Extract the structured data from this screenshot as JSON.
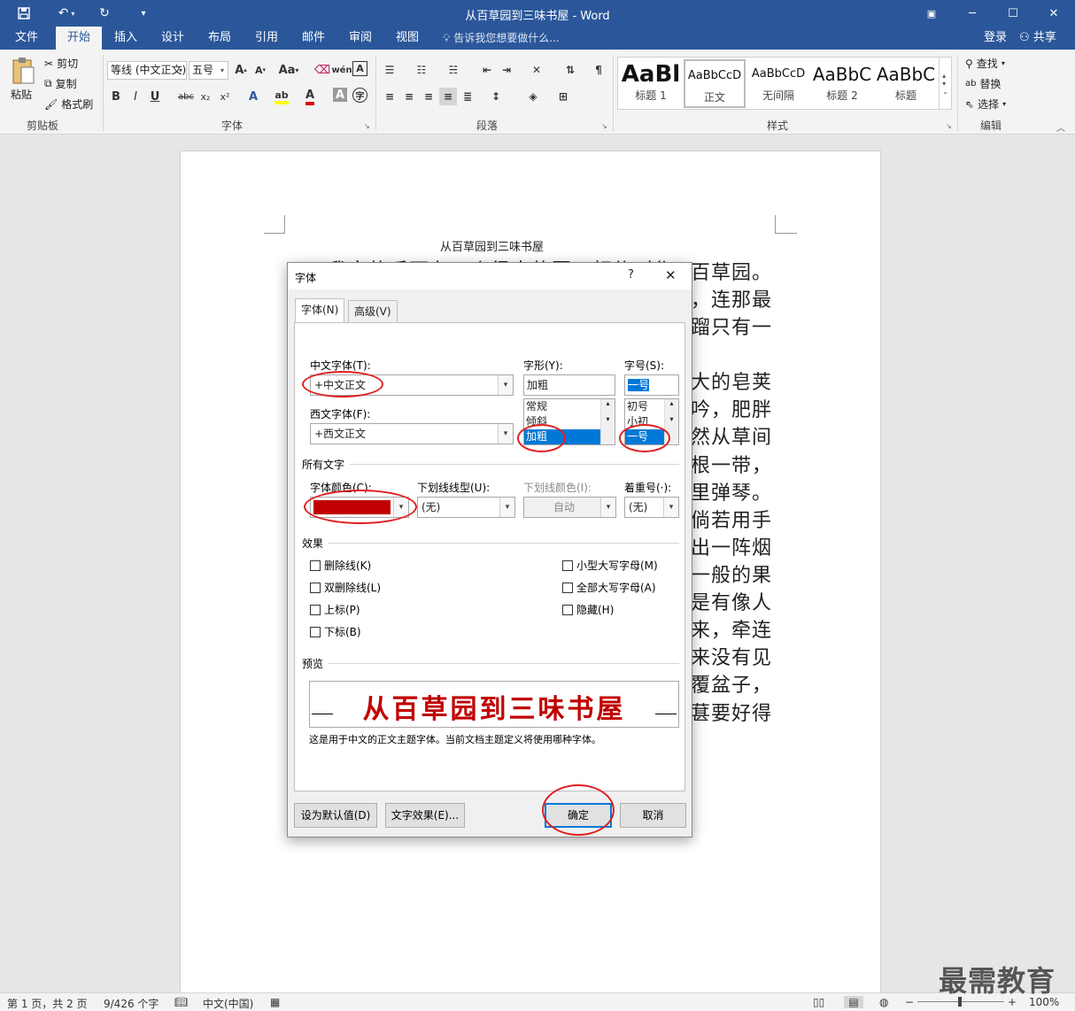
{
  "window": {
    "title": "从百草园到三味书屋 - Word"
  },
  "tabs": [
    {
      "label": "文件"
    },
    {
      "label": "开始"
    },
    {
      "label": "插入"
    },
    {
      "label": "设计"
    },
    {
      "label": "布局"
    },
    {
      "label": "引用"
    },
    {
      "label": "邮件"
    },
    {
      "label": "审阅"
    },
    {
      "label": "视图"
    }
  ],
  "tellme": "告诉我您想要做什么...",
  "account": {
    "login": "登录",
    "share": "共享"
  },
  "ribbon": {
    "clipboard": {
      "paste": "粘贴",
      "cut": "剪切",
      "copy": "复制",
      "format_painter": "格式刷",
      "label": "剪贴板"
    },
    "font": {
      "font_name": "等线 (中文正文)",
      "font_size": "五号",
      "label": "字体"
    },
    "paragraph": {
      "label": "段落"
    },
    "styles": {
      "label": "样式",
      "items": [
        {
          "preview": "AaBl",
          "name": "标题 1"
        },
        {
          "preview": "AaBbCcD",
          "name": "正文"
        },
        {
          "preview": "AaBbCcD",
          "name": "无间隔"
        },
        {
          "preview": "AaBbC",
          "name": "标题 2"
        },
        {
          "preview": "AaBbC",
          "name": "标题"
        }
      ]
    },
    "editing": {
      "find": "查找",
      "replace": "替换",
      "select": "选择",
      "label": "编辑"
    }
  },
  "document": {
    "header": "从百草园到三味书屋",
    "right_lines": [
      "百草园。",
      "，连那最",
      "蹓只有一",
      "大的皂荚",
      "吟，肥胖",
      "然从草间",
      "根一带，",
      "里弹琴。",
      "倘若用手",
      "出一阵烟",
      "一般的果",
      "是有像人",
      "来，牵连",
      "来没有见",
      "覆盆子，",
      "葚要好得"
    ],
    "top_line": "我家的后面有一个很大的园，相传叫作"
  },
  "dialog": {
    "title": "字体",
    "help": "?",
    "close": "✕",
    "tab_font": "字体(N)",
    "tab_advanced": "高级(V)",
    "cn_font_label": "中文字体(T):",
    "cn_font_value": "+中文正文",
    "style_label": "字形(Y):",
    "style_value": "加粗",
    "style_options": [
      "常规",
      "倾斜",
      "加粗"
    ],
    "size_label": "字号(S):",
    "size_value": "一号",
    "size_options": [
      "初号",
      "小初",
      "一号"
    ],
    "west_font_label": "西文字体(F):",
    "west_font_value": "+西文正文",
    "all_text_label": "所有文字",
    "font_color_label": "字体颜色(C):",
    "font_color_value": "#c00000",
    "underline_label": "下划线线型(U):",
    "underline_value": "(无)",
    "underline_color_label": "下划线颜色(I):",
    "underline_color_value": "自动",
    "emphasis_label": "着重号(·):",
    "emphasis_value": "(无)",
    "effects_label": "效果",
    "effects": {
      "strike": "删除线(K)",
      "double_strike": "双删除线(L)",
      "superscript": "上标(P)",
      "subscript": "下标(B)",
      "small_caps": "小型大写字母(M)",
      "all_caps": "全部大写字母(A)",
      "hidden": "隐藏(H)"
    },
    "preview_label": "预览",
    "preview_text": "从百草园到三味书屋",
    "preview_note": "这是用于中文的正文主题字体。当前文档主题定义将使用哪种字体。",
    "btn_default": "设为默认值(D)",
    "btn_effects": "文字效果(E)...",
    "btn_ok": "确定",
    "btn_cancel": "取消"
  },
  "status": {
    "page": "第 1 页，共 2 页",
    "words": "9/426 个字",
    "lang": "中文(中国)",
    "zoom": "100%"
  },
  "watermark": "最需教育"
}
